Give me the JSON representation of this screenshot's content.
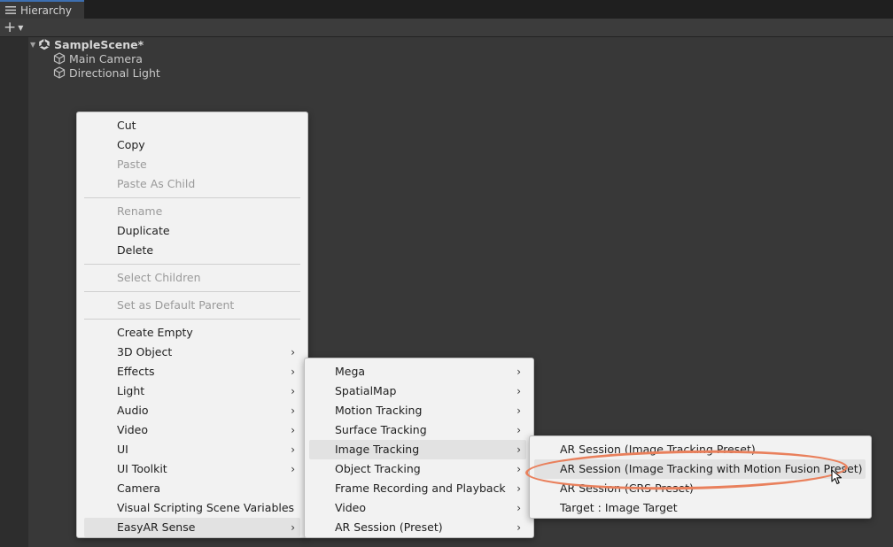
{
  "window": {
    "tab_label": "Hierarchy",
    "add_plus": "+",
    "add_caret": "▼"
  },
  "hierarchy": {
    "scene_name": "SampleScene*",
    "objects": [
      "Main Camera",
      "Directional Light"
    ]
  },
  "context_menu": {
    "groups": [
      [
        {
          "label": "Cut",
          "enabled": true
        },
        {
          "label": "Copy",
          "enabled": true
        },
        {
          "label": "Paste",
          "enabled": false
        },
        {
          "label": "Paste As Child",
          "enabled": false
        }
      ],
      [
        {
          "label": "Rename",
          "enabled": false
        },
        {
          "label": "Duplicate",
          "enabled": true
        },
        {
          "label": "Delete",
          "enabled": true
        }
      ],
      [
        {
          "label": "Select Children",
          "enabled": false
        }
      ],
      [
        {
          "label": "Set as Default Parent",
          "enabled": false
        }
      ],
      [
        {
          "label": "Create Empty",
          "enabled": true
        },
        {
          "label": "3D Object",
          "enabled": true,
          "submenu": true
        },
        {
          "label": "Effects",
          "enabled": true,
          "submenu": true
        },
        {
          "label": "Light",
          "enabled": true,
          "submenu": true
        },
        {
          "label": "Audio",
          "enabled": true,
          "submenu": true
        },
        {
          "label": "Video",
          "enabled": true,
          "submenu": true
        },
        {
          "label": "UI",
          "enabled": true,
          "submenu": true
        },
        {
          "label": "UI Toolkit",
          "enabled": true,
          "submenu": true
        },
        {
          "label": "Camera",
          "enabled": true
        },
        {
          "label": "Visual Scripting Scene Variables",
          "enabled": true
        },
        {
          "label": "EasyAR Sense",
          "enabled": true,
          "submenu": true,
          "active": true
        }
      ]
    ]
  },
  "easyar_menu": {
    "items": [
      {
        "label": "Mega",
        "submenu": true
      },
      {
        "label": "SpatialMap",
        "submenu": true
      },
      {
        "label": "Motion Tracking",
        "submenu": true
      },
      {
        "label": "Surface Tracking",
        "submenu": true
      },
      {
        "label": "Image Tracking",
        "submenu": true,
        "active": true
      },
      {
        "label": "Object Tracking",
        "submenu": true
      },
      {
        "label": "Frame Recording and Playback",
        "submenu": true
      },
      {
        "label": "Video",
        "submenu": true
      },
      {
        "label": "AR Session (Preset)",
        "submenu": true
      }
    ]
  },
  "image_tracking_menu": {
    "items": [
      {
        "label": "AR Session (Image Tracking Preset)"
      },
      {
        "label": "AR Session (Image Tracking with Motion Fusion Preset)",
        "active": true
      },
      {
        "label": "AR Session (CRS Preset)"
      },
      {
        "label": "Target : Image Target"
      }
    ]
  },
  "submenu_glyph": "›",
  "colors": {
    "highlight_ellipse": "#e9805c",
    "tab_accent": "#3d6fb0"
  }
}
